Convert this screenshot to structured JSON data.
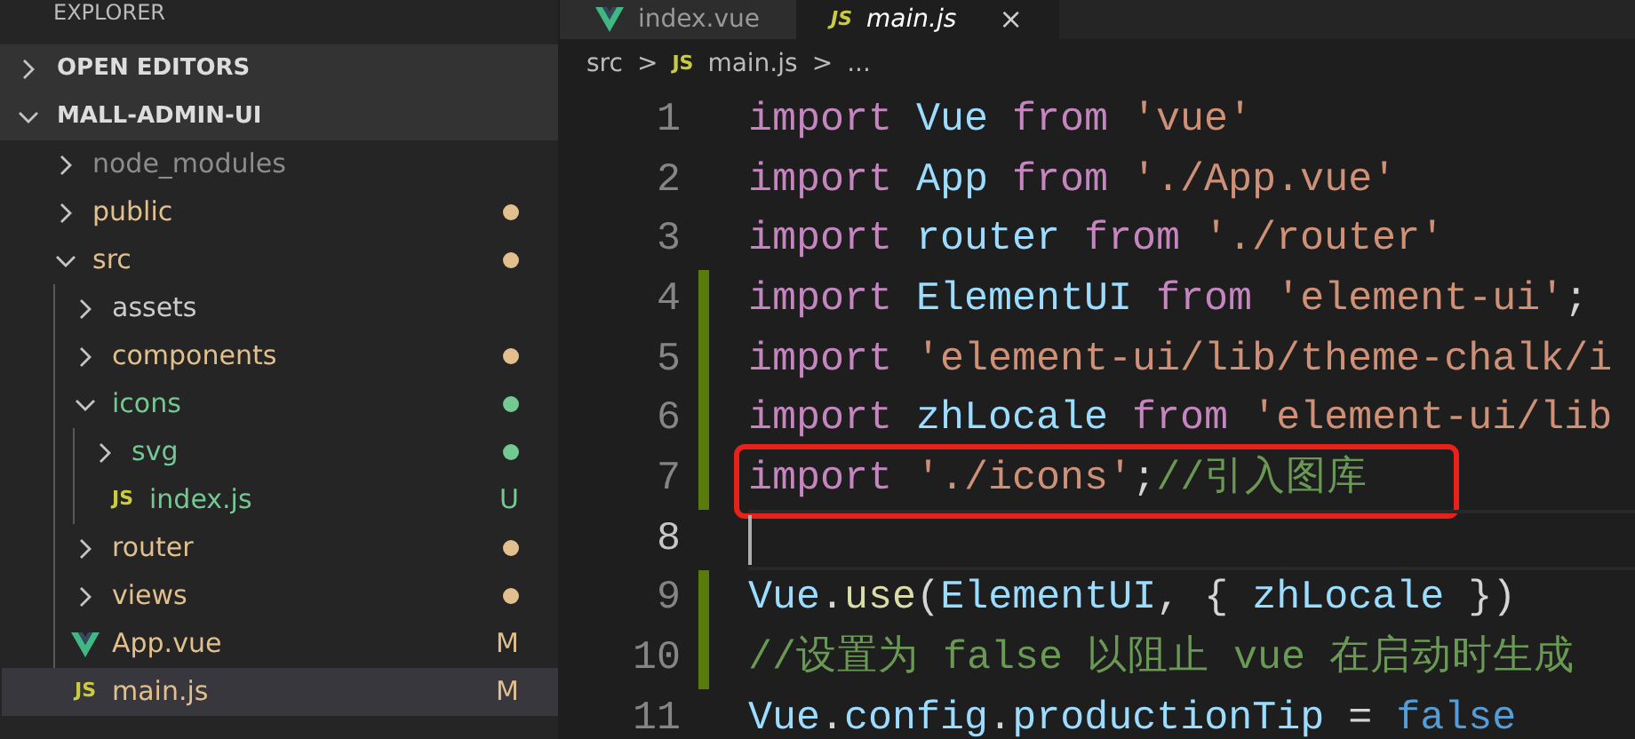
{
  "sidebar": {
    "title": "EXPLORER",
    "sections": [
      {
        "label": "OPEN EDITORS",
        "expanded": false
      },
      {
        "label": "MALL-ADMIN-UI",
        "expanded": true
      }
    ],
    "tree": [
      {
        "kind": "folder",
        "name": "node_modules",
        "color": "#8c8c8c",
        "dot": false,
        "expanded": false
      },
      {
        "kind": "folder",
        "name": "public",
        "color": "#e2c08d",
        "dot": true,
        "expanded": false
      },
      {
        "kind": "folder",
        "name": "src",
        "color": "#e2c08d",
        "dot": true,
        "expanded": true,
        "children": [
          {
            "kind": "folder",
            "name": "assets",
            "color": "#cccccc",
            "dot": false,
            "expanded": false
          },
          {
            "kind": "folder",
            "name": "components",
            "color": "#e2c08d",
            "dot": true,
            "expanded": false
          },
          {
            "kind": "folder",
            "name": "icons",
            "color": "#73c991",
            "dot": true,
            "expanded": true,
            "children": [
              {
                "kind": "folder",
                "name": "svg",
                "color": "#73c991",
                "dot": true,
                "expanded": false
              },
              {
                "kind": "js",
                "icon_text": "JS",
                "name": "index.js",
                "color": "#73c991",
                "badge": "U",
                "selected": false
              }
            ]
          },
          {
            "kind": "folder",
            "name": "router",
            "color": "#e2c08d",
            "dot": true,
            "expanded": false
          },
          {
            "kind": "folder",
            "name": "views",
            "color": "#e2c08d",
            "dot": true,
            "expanded": false
          },
          {
            "kind": "vue",
            "name": "App.vue",
            "color": "#e2c08d",
            "badge": "M",
            "selected": false
          },
          {
            "kind": "js",
            "icon_text": "JS",
            "name": "main.js",
            "color": "#e2c08d",
            "badge": "M",
            "selected": true
          }
        ]
      }
    ]
  },
  "tabs": [
    {
      "kind": "vue",
      "label": "index.vue",
      "selected": false
    },
    {
      "kind": "js",
      "icon_text": "JS",
      "label": "main.js",
      "selected": true,
      "close": "×"
    }
  ],
  "breadcrumb": [
    {
      "kind": "text",
      "text": "src"
    },
    {
      "kind": "sep",
      "text": ">"
    },
    {
      "kind": "js",
      "icon_text": "JS",
      "text": "main.js"
    },
    {
      "kind": "sep",
      "text": ">"
    },
    {
      "kind": "text",
      "text": "..."
    }
  ],
  "editor": {
    "lines": [
      {
        "number": "1",
        "changed": false,
        "tokens": [
          {
            "kind": "keyword",
            "text": "import "
          },
          {
            "kind": "variable",
            "text": "Vue "
          },
          {
            "kind": "keyword",
            "text": "from "
          },
          {
            "kind": "string",
            "text": "'vue'"
          }
        ]
      },
      {
        "number": "2",
        "changed": false,
        "tokens": [
          {
            "kind": "keyword",
            "text": "import "
          },
          {
            "kind": "variable",
            "text": "App "
          },
          {
            "kind": "keyword",
            "text": "from "
          },
          {
            "kind": "string",
            "text": "'./App.vue'"
          }
        ]
      },
      {
        "number": "3",
        "changed": false,
        "tokens": [
          {
            "kind": "keyword",
            "text": "import "
          },
          {
            "kind": "variable",
            "text": "router "
          },
          {
            "kind": "keyword",
            "text": "from "
          },
          {
            "kind": "string",
            "text": "'./router'"
          }
        ]
      },
      {
        "number": "4",
        "changed": true,
        "tokens": [
          {
            "kind": "keyword",
            "text": "import "
          },
          {
            "kind": "variable",
            "text": "ElementUI "
          },
          {
            "kind": "keyword",
            "text": "from "
          },
          {
            "kind": "string",
            "text": "'element-ui'"
          },
          {
            "kind": "punct",
            "text": ";"
          }
        ]
      },
      {
        "number": "5",
        "changed": true,
        "tokens": [
          {
            "kind": "keyword",
            "text": "import "
          },
          {
            "kind": "string",
            "text": "'element-ui/lib/theme-chalk/i"
          }
        ]
      },
      {
        "number": "6",
        "changed": true,
        "tokens": [
          {
            "kind": "keyword",
            "text": "import "
          },
          {
            "kind": "variable",
            "text": "zhLocale "
          },
          {
            "kind": "keyword",
            "text": "from "
          },
          {
            "kind": "string",
            "text": "'element-ui/lib"
          }
        ]
      },
      {
        "number": "7",
        "changed": true,
        "highlight": true,
        "tokens": [
          {
            "kind": "keyword",
            "text": "import "
          },
          {
            "kind": "string",
            "text": "'./icons'"
          },
          {
            "kind": "punct",
            "text": ";"
          },
          {
            "kind": "comment",
            "text": "//引入图库"
          }
        ]
      },
      {
        "number": "8",
        "changed": false,
        "current": true
      },
      {
        "number": "9",
        "changed": true,
        "tokens": [
          {
            "kind": "variable",
            "text": "Vue"
          },
          {
            "kind": "punct",
            "text": "."
          },
          {
            "kind": "function",
            "text": "use"
          },
          {
            "kind": "punct",
            "text": "("
          },
          {
            "kind": "variable",
            "text": "ElementUI"
          },
          {
            "kind": "punct",
            "text": ", { "
          },
          {
            "kind": "variable",
            "text": "zhLocale"
          },
          {
            "kind": "punct",
            "text": " })"
          }
        ]
      },
      {
        "number": "10",
        "changed": true,
        "tokens": [
          {
            "kind": "comment",
            "text": "//设置为 false 以阻止 vue 在启动时生成"
          }
        ]
      },
      {
        "number": "11",
        "changed": false,
        "tokens": [
          {
            "kind": "variable",
            "text": "Vue"
          },
          {
            "kind": "punct",
            "text": "."
          },
          {
            "kind": "variable",
            "text": "config"
          },
          {
            "kind": "punct",
            "text": "."
          },
          {
            "kind": "variable",
            "text": "productionTip"
          },
          {
            "kind": "punct",
            "text": " = "
          },
          {
            "kind": "constant",
            "text": "false"
          }
        ]
      }
    ]
  }
}
